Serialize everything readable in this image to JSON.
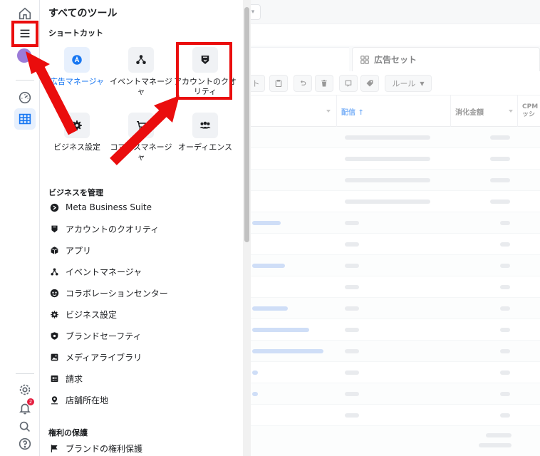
{
  "panel": {
    "title": "すべてのツール",
    "shortcuts_label": "ショートカット",
    "shortcuts": [
      {
        "label": "広告マネージャ",
        "icon": "ads-manager-icon",
        "active": true
      },
      {
        "label": "イベントマネージャ",
        "icon": "events-manager-icon",
        "active": false
      },
      {
        "label": "アカウントのクオリティ",
        "icon": "account-quality-icon",
        "active": false
      },
      {
        "label": "ビジネス設定",
        "icon": "gear-icon",
        "active": false
      },
      {
        "label": "コマースマネージャ",
        "icon": "cart-icon",
        "active": false
      },
      {
        "label": "オーディエンス",
        "icon": "audience-icon",
        "active": false
      }
    ],
    "manage_label": "ビジネスを管理",
    "manage_items": [
      {
        "label": "Meta Business Suite",
        "icon": "meta-business-suite-icon"
      },
      {
        "label": "アカウントのクオリティ",
        "icon": "account-quality-icon"
      },
      {
        "label": "アプリ",
        "icon": "app-cube-icon"
      },
      {
        "label": "イベントマネージャ",
        "icon": "events-manager-icon"
      },
      {
        "label": "コラボレーションセンター",
        "icon": "collaboration-icon"
      },
      {
        "label": "ビジネス設定",
        "icon": "gear-icon"
      },
      {
        "label": "ブランドセーフティ",
        "icon": "shield-icon"
      },
      {
        "label": "メディアライブラリ",
        "icon": "media-library-icon"
      },
      {
        "label": "請求",
        "icon": "billing-icon"
      },
      {
        "label": "店舗所在地",
        "icon": "store-location-icon"
      }
    ],
    "rights_label": "権利の保護",
    "rights_items": [
      {
        "label": "ブランドの権利保護",
        "icon": "flag-icon"
      }
    ]
  },
  "rail": {
    "notification_count": "2"
  },
  "background": {
    "tab_ad_sets": "広告セット",
    "rule_button": "ルール",
    "col_delivery": "配信 ↑",
    "col_spend": "消化金額",
    "col_cpm": "CPM ッシ"
  },
  "colors": {
    "accent": "#1877f2",
    "highlight": "#ea0d0d"
  }
}
